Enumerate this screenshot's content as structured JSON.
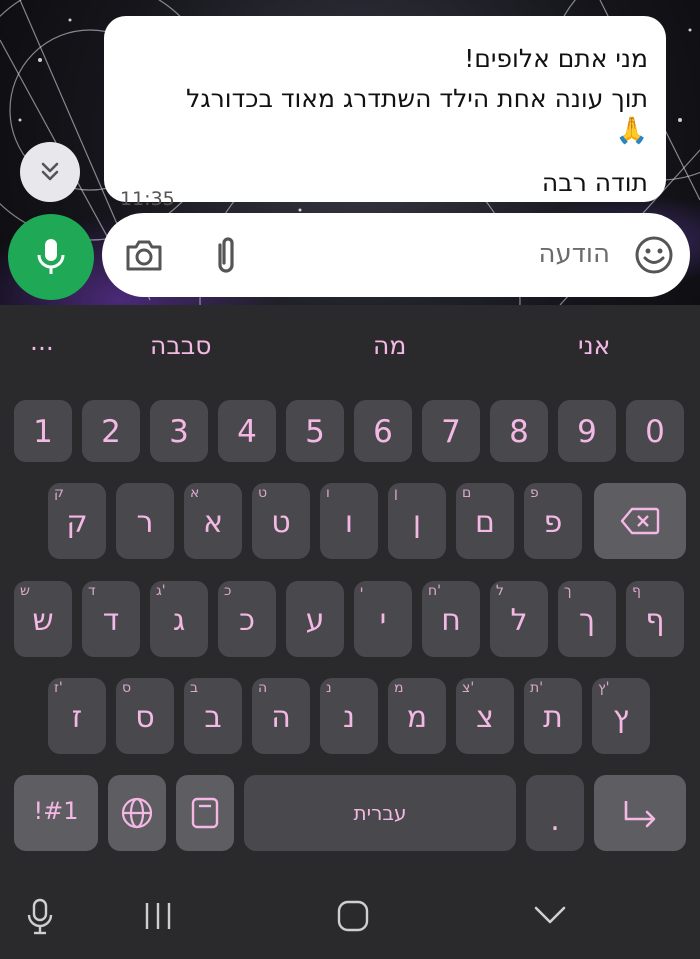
{
  "chat": {
    "message": {
      "line1": "מני אתם אלופים!",
      "line2": "תוך עונה אחת הילד השתדרג מאוד בכדורגל",
      "emoji": "🙏",
      "line3": "תודה רבה",
      "time": "11:35"
    },
    "scroll_down_icon": "chevron-double-down",
    "input": {
      "placeholder": "הודעה",
      "icons": [
        "camera",
        "paperclip",
        "smiley",
        "microphone"
      ]
    }
  },
  "keyboard": {
    "suggestions": [
      "...",
      "סבבה",
      "מה",
      "אני"
    ],
    "numbers": [
      "1",
      "2",
      "3",
      "4",
      "5",
      "6",
      "7",
      "8",
      "9",
      "0"
    ],
    "row1": [
      {
        "main": "ק",
        "hint": "ק"
      },
      {
        "main": "ר",
        "hint": ""
      },
      {
        "main": "א",
        "hint": "א"
      },
      {
        "main": "ט",
        "hint": "ט"
      },
      {
        "main": "ו",
        "hint": "ו"
      },
      {
        "main": "ן",
        "hint": "ן"
      },
      {
        "main": "ם",
        "hint": "ם"
      },
      {
        "main": "פ",
        "hint": "פ"
      }
    ],
    "row2": [
      {
        "main": "ש",
        "hint": "ש"
      },
      {
        "main": "ד",
        "hint": "ד"
      },
      {
        "main": "ג",
        "hint": "ג'"
      },
      {
        "main": "כ",
        "hint": "כ"
      },
      {
        "main": "ע",
        "hint": ""
      },
      {
        "main": "י",
        "hint": "י"
      },
      {
        "main": "ח",
        "hint": "ח'"
      },
      {
        "main": "ל",
        "hint": "ל"
      },
      {
        "main": "ך",
        "hint": "ך"
      },
      {
        "main": "ף",
        "hint": "ף"
      }
    ],
    "row3": [
      {
        "main": "ז",
        "hint": "ז'"
      },
      {
        "main": "ס",
        "hint": "ס"
      },
      {
        "main": "ב",
        "hint": "ב"
      },
      {
        "main": "ה",
        "hint": "ה"
      },
      {
        "main": "נ",
        "hint": "נ"
      },
      {
        "main": "מ",
        "hint": "מ"
      },
      {
        "main": "צ",
        "hint": "צ'"
      },
      {
        "main": "ת",
        "hint": "ת'"
      },
      {
        "main": "ץ",
        "hint": "ץ'"
      }
    ],
    "bottom": {
      "symbols": "!#1",
      "space": "עברית",
      "period": "."
    },
    "colors": {
      "key": "#49484d",
      "text": "#f3b8e4",
      "background": "#2a2a2d"
    }
  },
  "navbar": {
    "icons": [
      "keyboard-mic",
      "recent-apps",
      "home",
      "back-down"
    ]
  }
}
